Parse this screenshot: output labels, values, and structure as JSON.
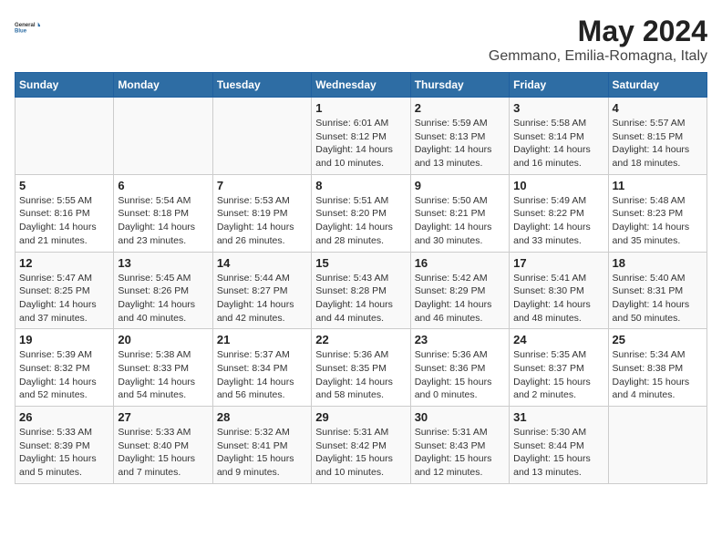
{
  "header": {
    "logo_line1": "General",
    "logo_line2": "Blue",
    "title": "May 2024",
    "subtitle": "Gemmano, Emilia-Romagna, Italy"
  },
  "days_of_week": [
    "Sunday",
    "Monday",
    "Tuesday",
    "Wednesday",
    "Thursday",
    "Friday",
    "Saturday"
  ],
  "weeks": [
    [
      {
        "num": "",
        "info": ""
      },
      {
        "num": "",
        "info": ""
      },
      {
        "num": "",
        "info": ""
      },
      {
        "num": "1",
        "info": "Sunrise: 6:01 AM\nSunset: 8:12 PM\nDaylight: 14 hours\nand 10 minutes."
      },
      {
        "num": "2",
        "info": "Sunrise: 5:59 AM\nSunset: 8:13 PM\nDaylight: 14 hours\nand 13 minutes."
      },
      {
        "num": "3",
        "info": "Sunrise: 5:58 AM\nSunset: 8:14 PM\nDaylight: 14 hours\nand 16 minutes."
      },
      {
        "num": "4",
        "info": "Sunrise: 5:57 AM\nSunset: 8:15 PM\nDaylight: 14 hours\nand 18 minutes."
      }
    ],
    [
      {
        "num": "5",
        "info": "Sunrise: 5:55 AM\nSunset: 8:16 PM\nDaylight: 14 hours\nand 21 minutes."
      },
      {
        "num": "6",
        "info": "Sunrise: 5:54 AM\nSunset: 8:18 PM\nDaylight: 14 hours\nand 23 minutes."
      },
      {
        "num": "7",
        "info": "Sunrise: 5:53 AM\nSunset: 8:19 PM\nDaylight: 14 hours\nand 26 minutes."
      },
      {
        "num": "8",
        "info": "Sunrise: 5:51 AM\nSunset: 8:20 PM\nDaylight: 14 hours\nand 28 minutes."
      },
      {
        "num": "9",
        "info": "Sunrise: 5:50 AM\nSunset: 8:21 PM\nDaylight: 14 hours\nand 30 minutes."
      },
      {
        "num": "10",
        "info": "Sunrise: 5:49 AM\nSunset: 8:22 PM\nDaylight: 14 hours\nand 33 minutes."
      },
      {
        "num": "11",
        "info": "Sunrise: 5:48 AM\nSunset: 8:23 PM\nDaylight: 14 hours\nand 35 minutes."
      }
    ],
    [
      {
        "num": "12",
        "info": "Sunrise: 5:47 AM\nSunset: 8:25 PM\nDaylight: 14 hours\nand 37 minutes."
      },
      {
        "num": "13",
        "info": "Sunrise: 5:45 AM\nSunset: 8:26 PM\nDaylight: 14 hours\nand 40 minutes."
      },
      {
        "num": "14",
        "info": "Sunrise: 5:44 AM\nSunset: 8:27 PM\nDaylight: 14 hours\nand 42 minutes."
      },
      {
        "num": "15",
        "info": "Sunrise: 5:43 AM\nSunset: 8:28 PM\nDaylight: 14 hours\nand 44 minutes."
      },
      {
        "num": "16",
        "info": "Sunrise: 5:42 AM\nSunset: 8:29 PM\nDaylight: 14 hours\nand 46 minutes."
      },
      {
        "num": "17",
        "info": "Sunrise: 5:41 AM\nSunset: 8:30 PM\nDaylight: 14 hours\nand 48 minutes."
      },
      {
        "num": "18",
        "info": "Sunrise: 5:40 AM\nSunset: 8:31 PM\nDaylight: 14 hours\nand 50 minutes."
      }
    ],
    [
      {
        "num": "19",
        "info": "Sunrise: 5:39 AM\nSunset: 8:32 PM\nDaylight: 14 hours\nand 52 minutes."
      },
      {
        "num": "20",
        "info": "Sunrise: 5:38 AM\nSunset: 8:33 PM\nDaylight: 14 hours\nand 54 minutes."
      },
      {
        "num": "21",
        "info": "Sunrise: 5:37 AM\nSunset: 8:34 PM\nDaylight: 14 hours\nand 56 minutes."
      },
      {
        "num": "22",
        "info": "Sunrise: 5:36 AM\nSunset: 8:35 PM\nDaylight: 14 hours\nand 58 minutes."
      },
      {
        "num": "23",
        "info": "Sunrise: 5:36 AM\nSunset: 8:36 PM\nDaylight: 15 hours\nand 0 minutes."
      },
      {
        "num": "24",
        "info": "Sunrise: 5:35 AM\nSunset: 8:37 PM\nDaylight: 15 hours\nand 2 minutes."
      },
      {
        "num": "25",
        "info": "Sunrise: 5:34 AM\nSunset: 8:38 PM\nDaylight: 15 hours\nand 4 minutes."
      }
    ],
    [
      {
        "num": "26",
        "info": "Sunrise: 5:33 AM\nSunset: 8:39 PM\nDaylight: 15 hours\nand 5 minutes."
      },
      {
        "num": "27",
        "info": "Sunrise: 5:33 AM\nSunset: 8:40 PM\nDaylight: 15 hours\nand 7 minutes."
      },
      {
        "num": "28",
        "info": "Sunrise: 5:32 AM\nSunset: 8:41 PM\nDaylight: 15 hours\nand 9 minutes."
      },
      {
        "num": "29",
        "info": "Sunrise: 5:31 AM\nSunset: 8:42 PM\nDaylight: 15 hours\nand 10 minutes."
      },
      {
        "num": "30",
        "info": "Sunrise: 5:31 AM\nSunset: 8:43 PM\nDaylight: 15 hours\nand 12 minutes."
      },
      {
        "num": "31",
        "info": "Sunrise: 5:30 AM\nSunset: 8:44 PM\nDaylight: 15 hours\nand 13 minutes."
      },
      {
        "num": "",
        "info": ""
      }
    ]
  ]
}
